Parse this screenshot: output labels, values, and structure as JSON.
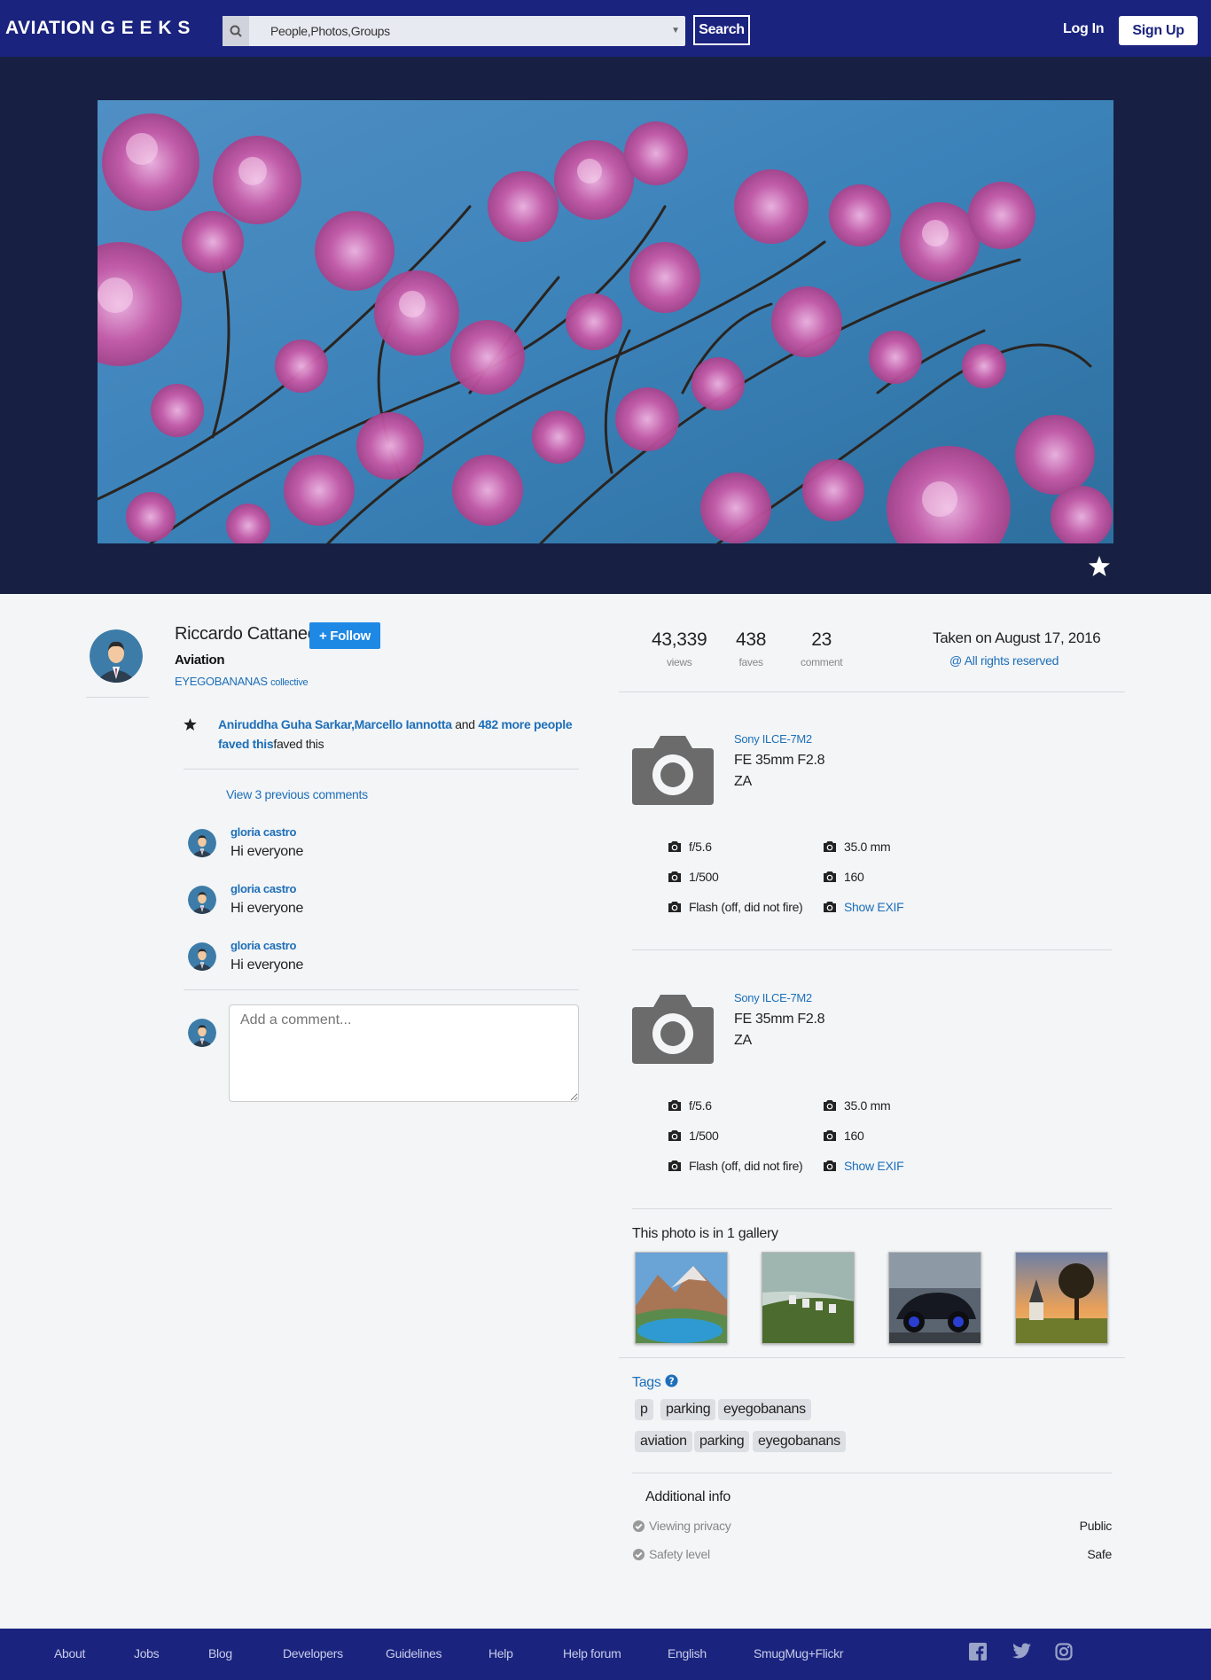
{
  "header": {
    "logo": "AVIATION G E E K S",
    "search_value": "People,Photos,Groups",
    "search_button": "Search",
    "login": "Log In",
    "signup": "Sign Up"
  },
  "author": {
    "name": "Riccardo Cattaneo",
    "follow": "+ Follow",
    "group": "Aviation",
    "collective": "EYEGOBANANAS",
    "collective_suffix": "collective"
  },
  "faves": {
    "people": "Aniruddha Guha Sarkar,Marcello Iannotta",
    "and": "and",
    "more": "482 more people faved this",
    "suffix": "faved this"
  },
  "comments": {
    "view_previous": "View 3 previous comments",
    "items": [
      {
        "author": "gloria castro",
        "text": "Hi everyone"
      },
      {
        "author": "gloria castro",
        "text": "Hi everyone"
      },
      {
        "author": "gloria castro",
        "text": "Hi everyone"
      }
    ],
    "placeholder": "Add a comment..."
  },
  "stats": {
    "views": "43,339",
    "views_label": "views",
    "faves": "438",
    "faves_label": "faves",
    "comments": "23",
    "comments_label": "comment",
    "taken": "Taken on August 17, 2016",
    "rights": "@ All rights reserved"
  },
  "exif": [
    {
      "model": "Sony ILCE-7M2",
      "lens": "FE 35mm F2.8 ZA",
      "aperture": "f/5.6",
      "focal": "35.0 mm",
      "shutter": "1/500",
      "iso": "160",
      "flash": "Flash (off, did not fire)",
      "show_exif": "Show EXIF"
    },
    {
      "model": "Sony ILCE-7M2",
      "lens": "FE 35mm F2.8 ZA",
      "aperture": "f/5.6",
      "focal": "35.0 mm",
      "shutter": "1/500",
      "iso": "160",
      "flash": "Flash (off, did not fire)",
      "show_exif": "Show EXIF"
    }
  ],
  "gallery": {
    "title": "This photo is in 1 gallery"
  },
  "tags": {
    "title": "Tags",
    "items": [
      "p",
      "parking",
      "eyegobanans",
      "aviation",
      "parking",
      "eyegobanans"
    ]
  },
  "additional": {
    "title": "Additional info",
    "privacy_label": "Viewing privacy",
    "privacy_value": "Public",
    "safety_label": "Safety level",
    "safety_value": "Safe"
  },
  "footer": {
    "links": [
      "About",
      "Jobs",
      "Blog",
      "Developers",
      "Guidelines",
      "Help",
      "Help forum",
      "English",
      "SmugMug+Flickr"
    ]
  },
  "colors": {
    "nav": "#1a237e",
    "hero_bg": "#172042",
    "link": "#1e6fb8",
    "follow": "#1e88e5"
  }
}
